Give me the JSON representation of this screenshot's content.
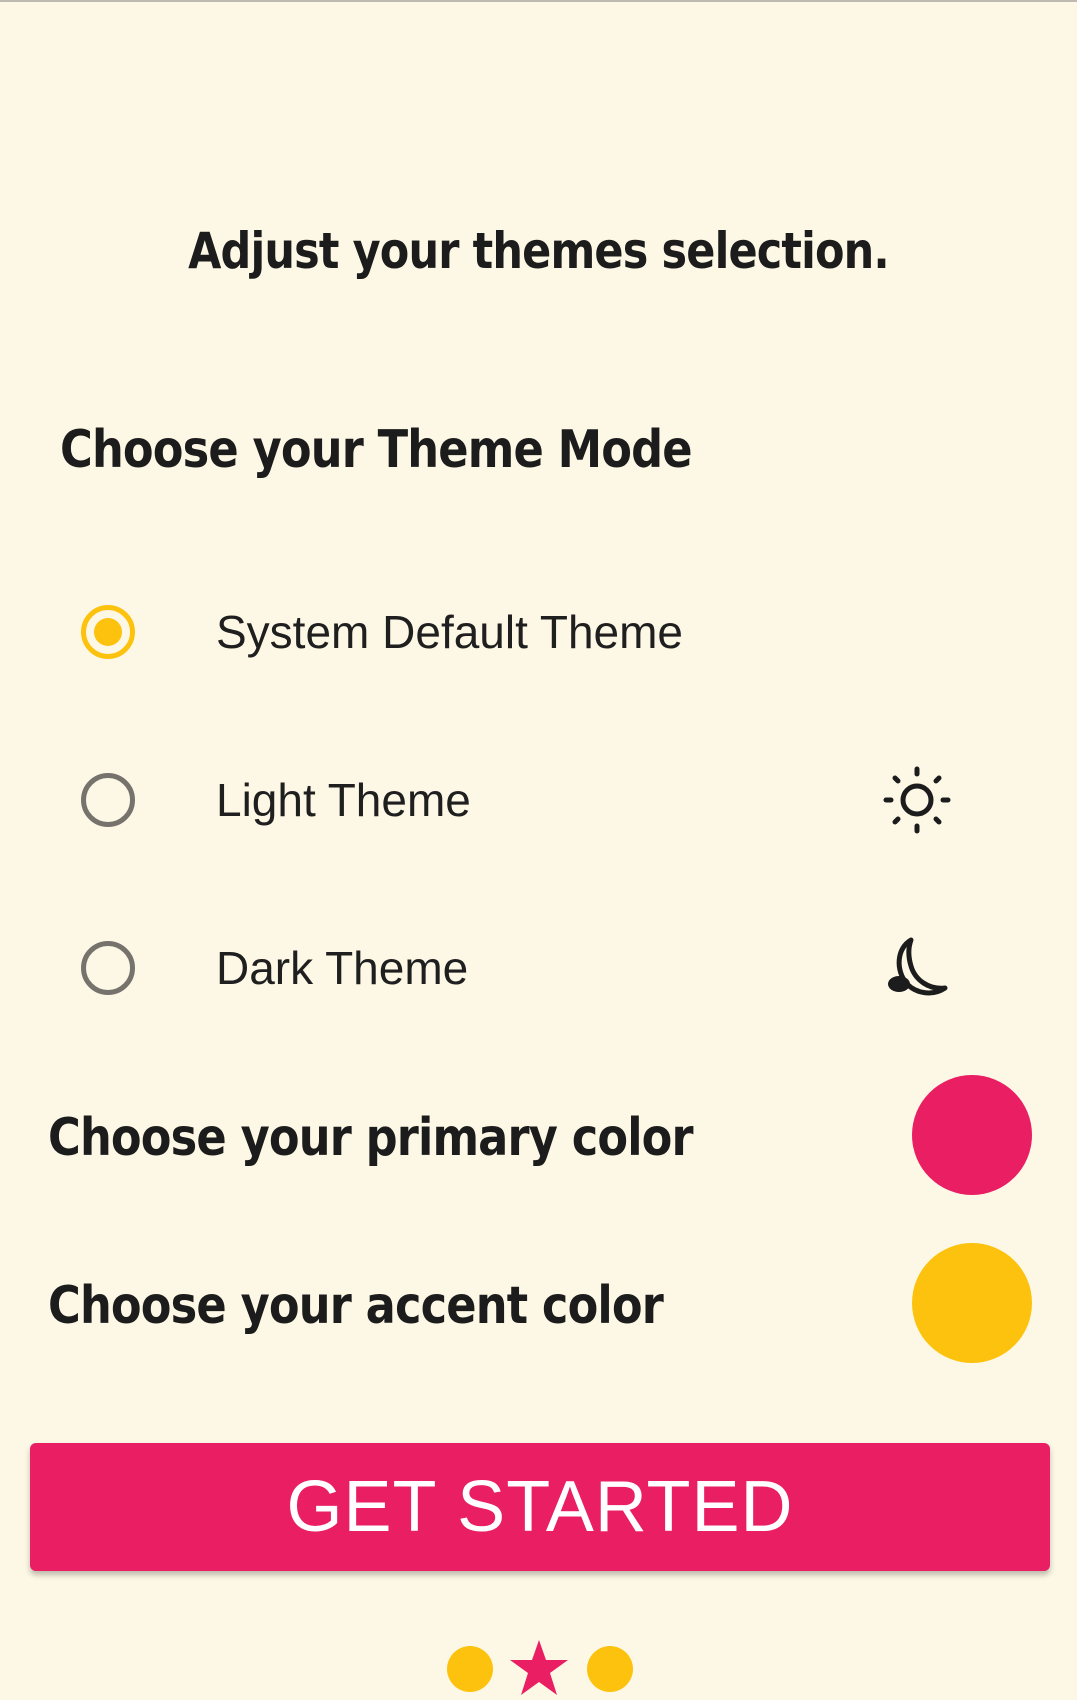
{
  "title": "Adjust your themes selection.",
  "theme_mode": {
    "heading": "Choose your Theme Mode",
    "selected": "system",
    "options": [
      {
        "id": "system",
        "label": "System Default Theme",
        "icon": ""
      },
      {
        "id": "light",
        "label": "Light Theme",
        "icon": "sun-icon"
      },
      {
        "id": "dark",
        "label": "Dark Theme",
        "icon": "moon-icon"
      }
    ]
  },
  "primary_color": {
    "label": "Choose your primary color",
    "value": "#E91E63"
  },
  "accent_color": {
    "label": "Choose your accent color",
    "value": "#FCC20E"
  },
  "get_started_label": "GET STARTED",
  "pager": {
    "pages": 3,
    "current": 2
  },
  "colors": {
    "background": "#FDF8E6",
    "primary": "#E91E63",
    "accent": "#FCC20E"
  }
}
